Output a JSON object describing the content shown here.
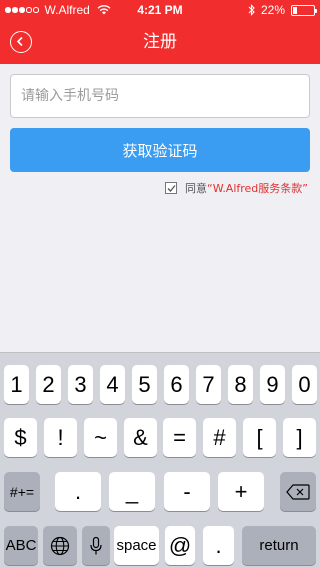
{
  "status_bar": {
    "carrier": "W.Alfred",
    "time": "4:21 PM",
    "battery_percent": "22%",
    "battery_level": 0.22
  },
  "header": {
    "title": "注册"
  },
  "form": {
    "phone_placeholder": "请输入手机号码",
    "get_code_label": "获取验证码",
    "agree_prefix": "同意",
    "terms_text": "“W.Alfred服务条款”",
    "agree_checked": true
  },
  "keyboard": {
    "row1": [
      "1",
      "2",
      "3",
      "4",
      "5",
      "6",
      "7",
      "8",
      "9",
      "0"
    ],
    "row2": [
      "$",
      "!",
      "~",
      "&",
      "=",
      "#",
      "[",
      "]"
    ],
    "row3_shift": "#+=",
    "row3": [
      ".",
      "_",
      "-",
      "+"
    ],
    "row4": {
      "abc": "ABC",
      "space": "space",
      "at": "@",
      "dot": ".",
      "return": "return"
    }
  },
  "colors": {
    "accent": "#f12d2d",
    "button": "#3a9df2",
    "terms": "#e2312f"
  }
}
